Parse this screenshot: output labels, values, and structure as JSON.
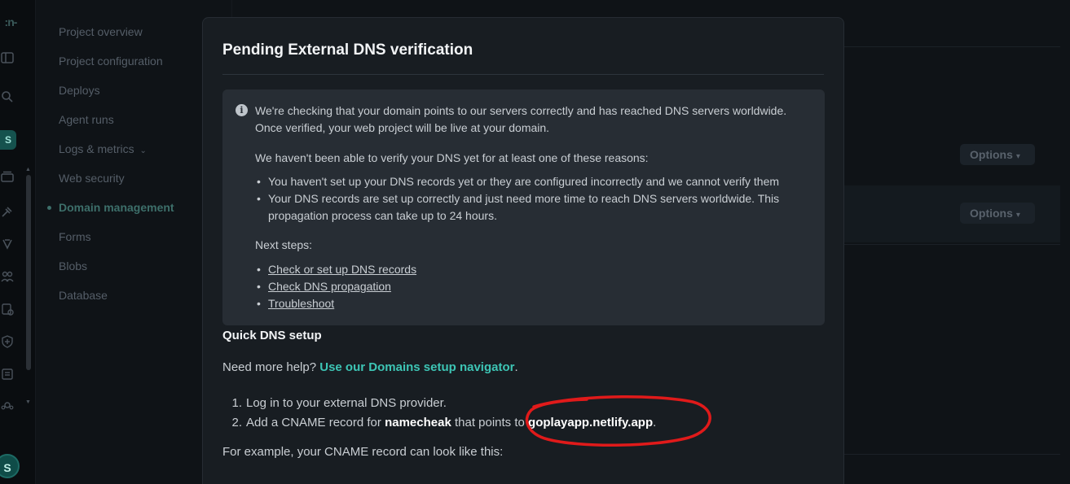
{
  "rail": {
    "site_badge": "S",
    "avatar": "S",
    "icons": [
      "netlify-logo-icon",
      "sidebar-toggle-icon",
      "search-icon",
      "builds-icon",
      "deploys-icon",
      "functions-icon",
      "team-icon",
      "forms-icon",
      "security-icon",
      "docs-icon",
      "integrations-icon"
    ]
  },
  "sidenav": {
    "items": [
      {
        "label": "Project overview"
      },
      {
        "label": "Project configuration"
      },
      {
        "label": "Deploys"
      },
      {
        "label": "Agent runs"
      },
      {
        "label": "Logs & metrics"
      },
      {
        "label": "Web security"
      },
      {
        "label": "Domain management",
        "active": true
      },
      {
        "label": "Forms"
      },
      {
        "label": "Blobs"
      },
      {
        "label": "Database"
      }
    ]
  },
  "background": {
    "options_label": "Options"
  },
  "modal": {
    "title": "Pending External DNS verification",
    "info": {
      "line1": "We're checking that your domain points to our servers correctly and has reached DNS servers worldwide.",
      "line2": "Once verified, your web project will be live at your domain.",
      "reasons_intro": "We haven't been able to verify your DNS yet for at least one of these reasons:",
      "reason1": "You haven't set up your DNS records yet or they are configured incorrectly and we cannot verify them",
      "reason2": "Your DNS records are set up correctly and just need more time to reach DNS servers worldwide. This propagation process can take up to 24 hours.",
      "next_steps_label": "Next steps:",
      "links": [
        "Check or set up DNS records",
        "Check DNS propagation",
        "Troubleshoot"
      ]
    },
    "quick_setup_title": "Quick DNS setup",
    "help_prefix": "Need more help?",
    "help_link": "Use our Domains setup navigator",
    "help_suffix": ".",
    "step1": "Log in to your external DNS provider.",
    "step2_prefix": "Add a CNAME record for",
    "step2_domain": "namecheak",
    "step2_middle": "that points to",
    "step2_target": "goplayapp.netlify.app",
    "step2_suffix": ".",
    "example": "For example, your CNAME record can look like this:"
  },
  "colors": {
    "accent": "#3dc5b5",
    "annotation": "#e01a1a"
  }
}
